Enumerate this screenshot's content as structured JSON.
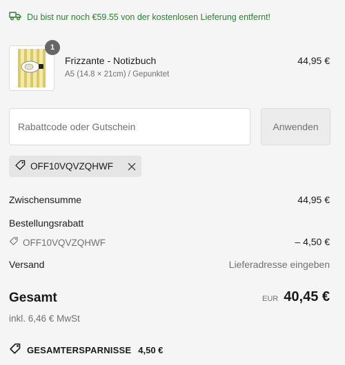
{
  "shipping_banner": {
    "text": "Du bist nur noch €59.55 von der kostenlosen Lieferung entfernt!",
    "icon": "delivery-truck-icon",
    "color": "#2e7d32"
  },
  "product": {
    "name": "Frizzante - Notizbuch",
    "variant": "A5 (14.8 × 21cm) / Gepunktet",
    "price": "44,95 €",
    "quantity": "1"
  },
  "discount_form": {
    "placeholder": "Rabattcode oder Gutschein",
    "apply_label": "Anwenden"
  },
  "applied_code": {
    "code": "OFF10VQVZQHWF",
    "icon": "tag-icon"
  },
  "summary": {
    "subtotal_label": "Zwischensumme",
    "subtotal_value": "44,95 €",
    "order_discount_label": "Bestellungsrabatt",
    "discount_code": "OFF10VQVZQHWF",
    "discount_value": "– 4,50 €",
    "shipping_label": "Versand",
    "shipping_value": "Lieferadresse eingeben",
    "total_label": "Gesamt",
    "currency": "EUR",
    "total_value": "40,45 €",
    "tax_note": "inkl. 6,46 € MwSt",
    "savings_label": "GESAMTERSPARNISSE",
    "savings_value": "4,50 €"
  }
}
